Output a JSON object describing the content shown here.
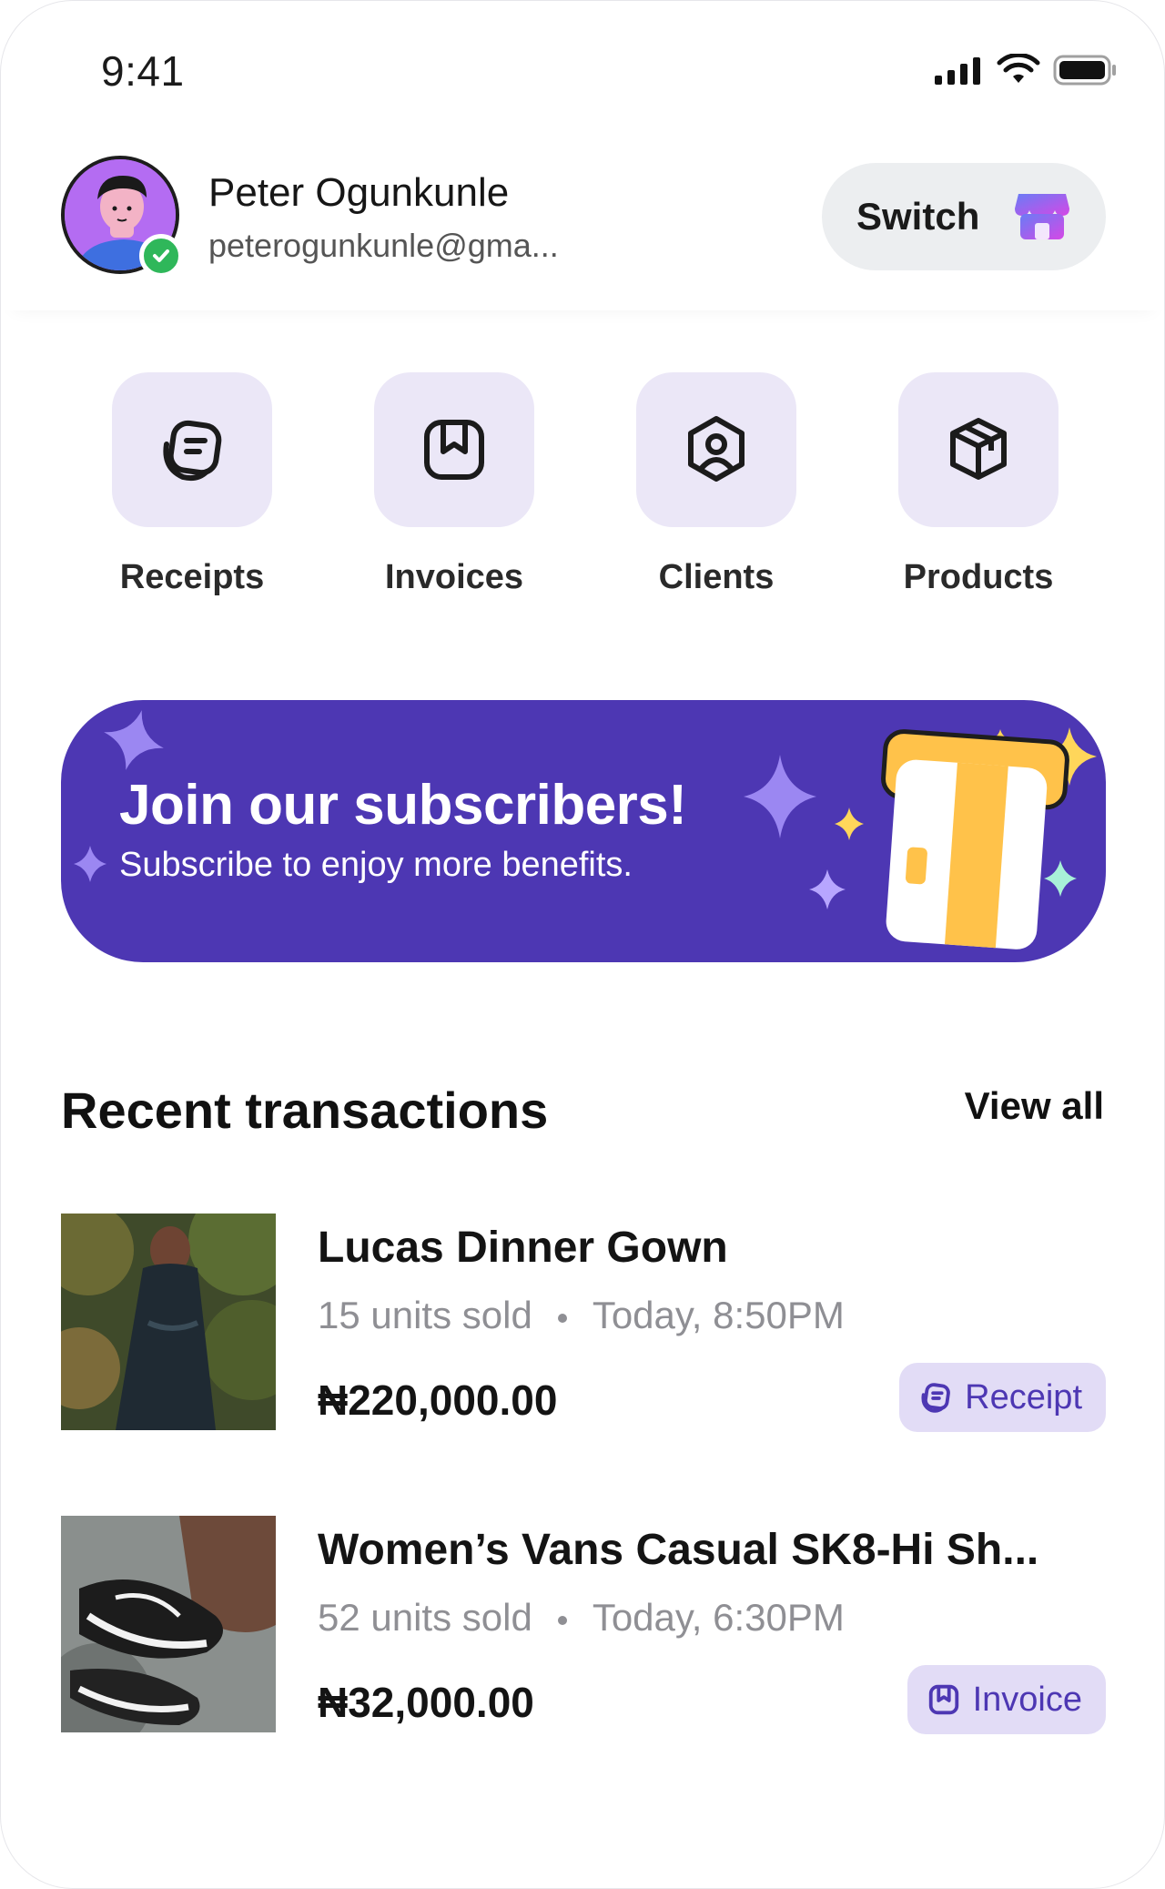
{
  "status_bar": {
    "time": "9:41"
  },
  "profile": {
    "name": "Peter Ogunkunle",
    "email": "peterogunkunle@gma...",
    "switch_label": "Switch"
  },
  "quick_actions": [
    {
      "label": "Receipts",
      "icon": "receipt-icon"
    },
    {
      "label": "Invoices",
      "icon": "invoice-icon"
    },
    {
      "label": "Clients",
      "icon": "client-icon"
    },
    {
      "label": "Products",
      "icon": "product-icon"
    }
  ],
  "banner": {
    "title": "Join our subscribers!",
    "subtitle": "Subscribe to enjoy more benefits."
  },
  "recent": {
    "title": "Recent transactions",
    "view_all": "View all",
    "items": [
      {
        "name": "Lucas Dinner Gown",
        "units": "15 units sold",
        "time": "Today, 8:50PM",
        "price": "₦220,000.00",
        "badge": "Receipt"
      },
      {
        "name": "Women’s Vans Casual SK8-Hi Sh...",
        "units": "52 units sold",
        "time": "Today, 6:30PM",
        "price": "₦32,000.00",
        "badge": "Invoice"
      }
    ]
  },
  "colors": {
    "accent": "#4d37b3",
    "tile": "#ebe7f7",
    "badge_bg": "#e2dcf6",
    "verified": "#2fb75a"
  }
}
